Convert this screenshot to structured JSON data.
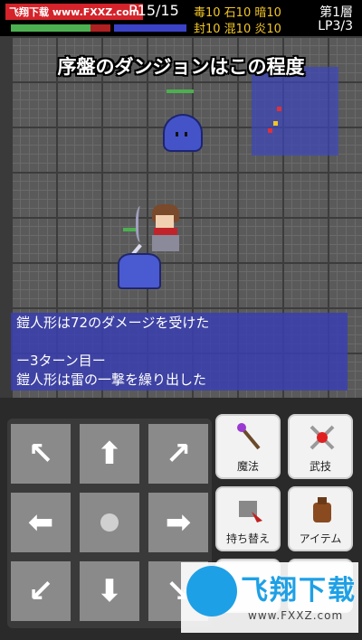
{
  "watermark_top": "飞翔下载 www.FXXZ.com",
  "hp": {
    "text": "P15/15",
    "fraction": 0.8
  },
  "status": {
    "row1": "毒10 石10 暗10",
    "row2": "封10 混10 炎10"
  },
  "floor": "第1層",
  "lp": "LP3/3",
  "caption": "序盤のダンジョンはこの程度",
  "log": [
    "鎧人形は72のダメージを受けた",
    "",
    "ー3ターン目ー",
    "鎧人形は雷の一撃を繰り出した"
  ],
  "actions": {
    "magic": "魔法",
    "skill": "武技",
    "switch": "持ち替え",
    "item": "アイテム"
  },
  "dpad_icons": {
    "up_left": "↖",
    "up": "⬆",
    "up_right": "↗",
    "left": "⬅",
    "right": "➡",
    "down_left": "↙",
    "down": "⬇",
    "down_right": "↘"
  },
  "watermark_bottom": {
    "text": "飞翔下载",
    "url": "www.FXXZ.com"
  },
  "colors": {
    "hp_green": "#4caf50",
    "hp_red": "#b02020",
    "status_yellow": "#f3c623",
    "log_bg": "#3a3eaf"
  }
}
